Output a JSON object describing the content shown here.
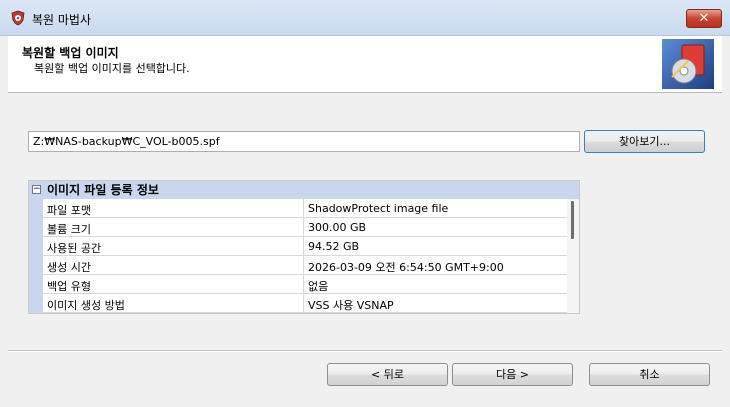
{
  "window": {
    "title": "복원 마법사"
  },
  "header": {
    "title": "복원할 백업 이미지",
    "subtitle": "복원할 백업 이미지를 선택합니다."
  },
  "path": {
    "value": "Z:₩NAS-backup₩C_VOL-b005.spf"
  },
  "browse_label": "찾아보기...",
  "properties": {
    "section_title": "이미지 파일 등록 정보",
    "rows": [
      {
        "name": "파일 포맷",
        "value": "ShadowProtect image file"
      },
      {
        "name": "볼륨 크기",
        "value": "300.00 GB"
      },
      {
        "name": "사용된 공간",
        "value": "94.52 GB"
      },
      {
        "name": "생성 시간",
        "value": "2026-03-09 오전 6:54:50 GMT+9:00"
      },
      {
        "name": "백업 유형",
        "value": "없음"
      },
      {
        "name": "이미지 생성 방법",
        "value": "VSS 사용 VSNAP"
      }
    ]
  },
  "footer": {
    "back_label": "< 뒤로",
    "next_label": "다음 >",
    "cancel_label": "취소"
  }
}
